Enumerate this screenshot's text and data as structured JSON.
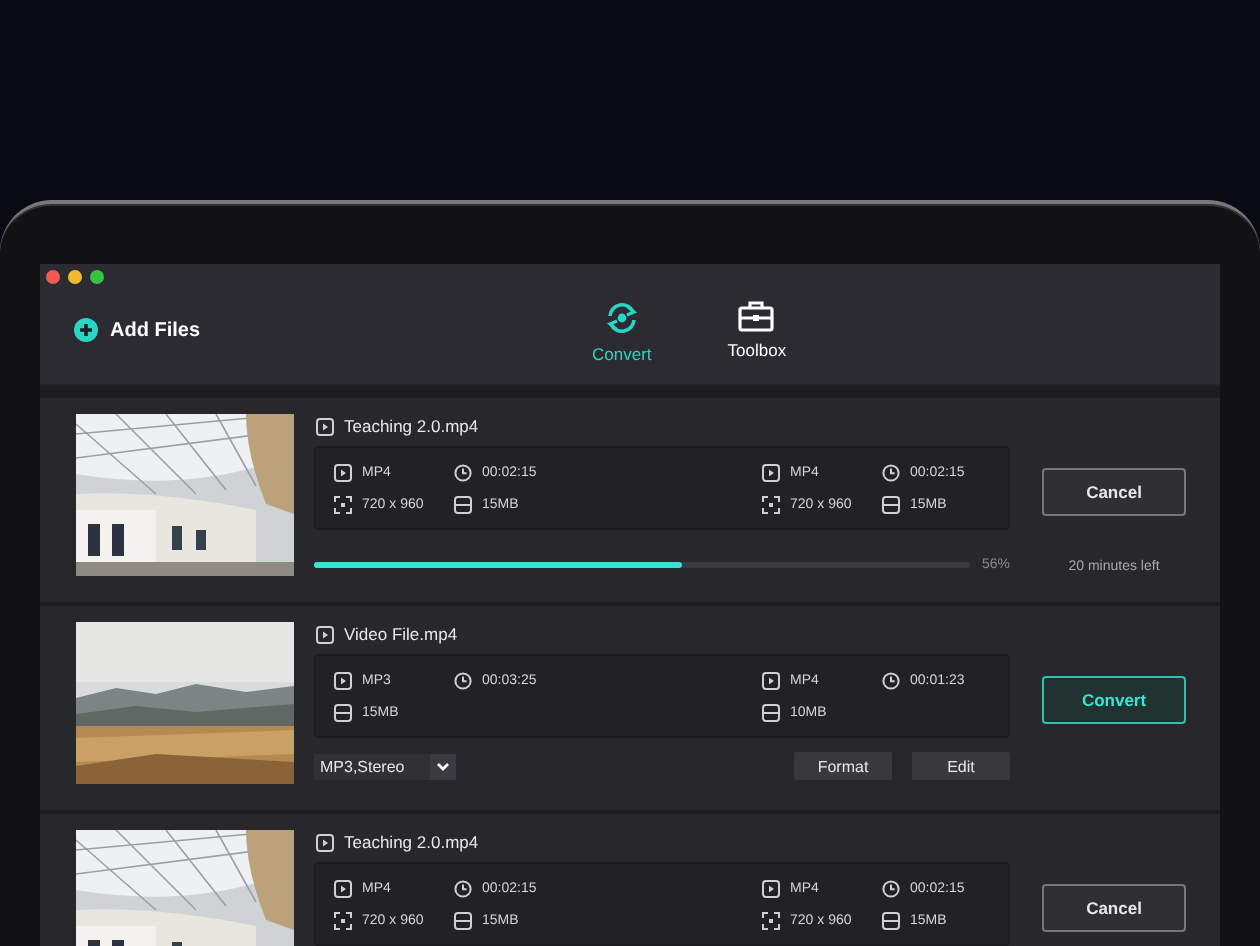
{
  "toolbar": {
    "add_files": "Add Files",
    "tabs": [
      {
        "label": "Convert",
        "selected": true,
        "kind": "convert"
      },
      {
        "label": "Toolbox",
        "selected": false,
        "kind": "toolbox"
      }
    ]
  },
  "items": [
    {
      "kind": "progress",
      "filename": "Teaching 2.0.mp4",
      "source": {
        "format": "MP4",
        "duration": "00:02:15",
        "resolution": "720 x 960",
        "size": "15MB"
      },
      "target": {
        "format": "MP4",
        "duration": "00:02:15",
        "resolution": "720 x 960",
        "size": "15MB"
      },
      "button": {
        "label": "Cancel",
        "kind": "cancel"
      },
      "progress": {
        "level": 0.56,
        "percent": "56%",
        "remaining": "20 minutes left"
      }
    },
    {
      "kind": "options",
      "filename": "Video File.mp4",
      "source": {
        "format": "MP3",
        "duration": "00:03:25",
        "size": "15MB"
      },
      "target": {
        "format": "MP4",
        "duration": "00:01:23",
        "size": "10MB"
      },
      "button": {
        "label": "Convert",
        "kind": "convert"
      },
      "options": {
        "audio": "MP3,Stereo",
        "buttons": [
          "Format",
          "Edit"
        ]
      }
    },
    {
      "kind": "plain",
      "filename": "Teaching 2.0.mp4",
      "source": {
        "format": "MP4",
        "duration": "00:02:15",
        "resolution": "720 x 960",
        "size": "15MB"
      },
      "target": {
        "format": "MP4",
        "duration": "00:02:15",
        "resolution": "720 x 960",
        "size": "15MB"
      },
      "button": {
        "label": "Cancel",
        "kind": "cancel"
      }
    }
  ]
}
